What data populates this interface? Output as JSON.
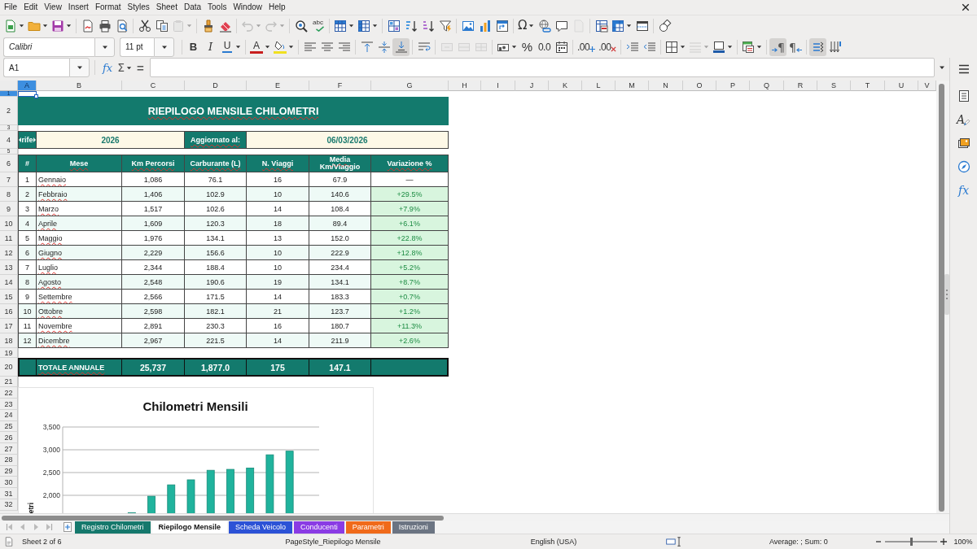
{
  "menu": [
    "File",
    "Edit",
    "View",
    "Insert",
    "Format",
    "Styles",
    "Sheet",
    "Data",
    "Tools",
    "Window",
    "Help"
  ],
  "standard_toolbar": [
    {
      "disabled": false
    },
    {
      "disabled": false
    },
    {
      "disabled": false
    },
    {
      "disabled": false
    },
    {
      "disabled": false
    },
    {
      "disabled": false
    },
    {
      "disabled": false
    },
    {
      "disabled": false
    },
    {
      "disabled": true
    },
    {
      "disabled": false
    },
    {
      "disabled": false
    },
    {
      "disabled": true
    },
    {
      "disabled": true
    },
    {
      "disabled": false
    },
    {
      "glyph": "abc",
      "disabled": false
    },
    {
      "disabled": false
    },
    {
      "disabled": false
    },
    {
      "disabled": false
    },
    {
      "disabled": false
    },
    {
      "disabled": false
    },
    {
      "disabled": false
    },
    {
      "disabled": false
    },
    {
      "disabled": false
    },
    {
      "disabled": false
    },
    {
      "glyph": "Ω",
      "disabled": false
    },
    {
      "disabled": false
    },
    {
      "disabled": false
    },
    {
      "disabled": true
    },
    {
      "disabled": false
    },
    {
      "disabled": false
    },
    {
      "disabled": false
    },
    {
      "disabled": false
    }
  ],
  "formatting_toolbar": {
    "font_name": "Calibri",
    "font_size": "11 pt",
    "buttons": [
      {
        "glyph": "B",
        "pressed": false,
        "disabled": false
      },
      {
        "glyph": "I",
        "pressed": false,
        "disabled": false
      },
      {
        "glyph": "U",
        "pressed": false,
        "disabled": false
      },
      {
        "glyph": "A",
        "pressed": false,
        "disabled": false
      },
      {
        "pressed": false,
        "disabled": false
      },
      {
        "pressed": false,
        "disabled": false
      },
      {
        "pressed": false,
        "disabled": false
      },
      {
        "pressed": false,
        "disabled": false
      },
      {
        "pressed": false,
        "disabled": false
      },
      {
        "pressed": false,
        "disabled": false
      },
      {
        "pressed": true,
        "disabled": false
      },
      {
        "pressed": false,
        "disabled": false
      },
      {
        "pressed": false,
        "disabled": true
      },
      {
        "pressed": false,
        "disabled": true
      },
      {
        "pressed": false,
        "disabled": true
      },
      {
        "pressed": false,
        "disabled": false
      },
      {
        "glyph": "%",
        "pressed": false,
        "disabled": false
      },
      {
        "glyph": "0.0",
        "pressed": false,
        "disabled": false
      },
      {
        "pressed": false,
        "disabled": false
      },
      {
        "glyph": ".00",
        "pressed": false,
        "disabled": false
      },
      {
        "glyph": ".00",
        "pressed": false,
        "disabled": false
      },
      {
        "pressed": false,
        "disabled": false
      },
      {
        "pressed": false,
        "disabled": false
      },
      {
        "pressed": false,
        "disabled": false
      },
      {
        "pressed": false,
        "disabled": true
      },
      {
        "pressed": false,
        "disabled": false
      },
      {
        "pressed": false,
        "disabled": false
      },
      {
        "glyph": "¶",
        "pressed": true,
        "disabled": false
      },
      {
        "glyph": "¶",
        "pressed": false,
        "disabled": false
      },
      {
        "pressed": true,
        "disabled": false
      },
      {
        "pressed": false,
        "disabled": false
      }
    ]
  },
  "formula_bar": {
    "cell_reference": "A1",
    "function_wizard": "fx",
    "sum": "Σ",
    "equals": "="
  },
  "sidebar": {
    "styles": "A",
    "functions": "fx"
  },
  "column_headers": [
    {
      "label": "A",
      "selected": true
    },
    {
      "label": "B",
      "selected": false
    },
    {
      "label": "C",
      "selected": false
    },
    {
      "label": "D",
      "selected": false
    },
    {
      "label": "E",
      "selected": false
    },
    {
      "label": "F",
      "selected": false
    },
    {
      "label": "G",
      "selected": false
    },
    {
      "label": "H",
      "selected": false
    },
    {
      "label": "I",
      "selected": false
    },
    {
      "label": "J",
      "selected": false
    },
    {
      "label": "K",
      "selected": false
    },
    {
      "label": "L",
      "selected": false
    },
    {
      "label": "M",
      "selected": false
    },
    {
      "label": "N",
      "selected": false
    },
    {
      "label": "O",
      "selected": false
    },
    {
      "label": "P",
      "selected": false
    },
    {
      "label": "Q",
      "selected": false
    },
    {
      "label": "R",
      "selected": false
    },
    {
      "label": "S",
      "selected": false
    },
    {
      "label": "T",
      "selected": false
    },
    {
      "label": "U",
      "selected": false
    },
    {
      "label": "V",
      "selected": false
    }
  ],
  "row_headers": [
    {
      "label": "1",
      "selected": true
    },
    {
      "label": "2",
      "selected": false
    },
    {
      "label": "3",
      "selected": false
    },
    {
      "label": "4",
      "selected": false
    },
    {
      "label": "5",
      "selected": false
    },
    {
      "label": "6",
      "selected": false
    },
    {
      "label": "7",
      "selected": false
    },
    {
      "label": "8",
      "selected": false
    },
    {
      "label": "9",
      "selected": false
    },
    {
      "label": "10",
      "selected": false
    },
    {
      "label": "11",
      "selected": false
    },
    {
      "label": "12",
      "selected": false
    },
    {
      "label": "13",
      "selected": false
    },
    {
      "label": "14",
      "selected": false
    },
    {
      "label": "15",
      "selected": false
    },
    {
      "label": "16",
      "selected": false
    },
    {
      "label": "17",
      "selected": false
    },
    {
      "label": "18",
      "selected": false
    },
    {
      "label": "19",
      "selected": false
    },
    {
      "label": "20",
      "selected": false
    },
    {
      "label": "21",
      "selected": false
    },
    {
      "label": "22",
      "selected": false
    },
    {
      "label": "23",
      "selected": false
    },
    {
      "label": "24",
      "selected": false
    },
    {
      "label": "25",
      "selected": false
    },
    {
      "label": "26",
      "selected": false
    },
    {
      "label": "27",
      "selected": false
    },
    {
      "label": "28",
      "selected": false
    },
    {
      "label": "29",
      "selected": false
    },
    {
      "label": "30",
      "selected": false
    },
    {
      "label": "31",
      "selected": false
    },
    {
      "label": "32",
      "selected": false
    }
  ],
  "sheet": {
    "title": {
      "text": "RIEPILOGO MENSILE CHILOMETRI",
      "misspelled": true
    },
    "info": [
      {
        "kind": "label",
        "text": "rife",
        "overflow": true
      },
      {
        "kind": "value",
        "text": "2026"
      },
      {
        "kind": "label",
        "text": "Aggiornato al:",
        "misspelled": true
      },
      {
        "kind": "value",
        "text": "06/03/2026"
      }
    ],
    "table": {
      "columns": [
        {
          "label": "#",
          "misspelled": false
        },
        {
          "label": "Mese",
          "misspelled": true
        },
        {
          "label": "Km Percorsi",
          "misspelled": true
        },
        {
          "label": "Carburante (L)",
          "misspelled": true
        },
        {
          "label": "N. Viaggi",
          "misspelled": true
        },
        {
          "label": "Media Km/Viaggio",
          "misspelled": true
        },
        {
          "label": "Variazione %",
          "misspelled": true
        }
      ],
      "rows": [
        {
          "n": "1",
          "month": "Gennaio",
          "km": "1,086",
          "fuel": "76.1",
          "trips": "16",
          "avg": "67.9",
          "change": "—",
          "change_highlighted": false,
          "misspelled": true
        },
        {
          "n": "2",
          "month": "Febbraio",
          "km": "1,406",
          "fuel": "102.9",
          "trips": "10",
          "avg": "140.6",
          "change": "+29.5%",
          "change_highlighted": true,
          "misspelled": true
        },
        {
          "n": "3",
          "month": "Marzo",
          "km": "1,517",
          "fuel": "102.6",
          "trips": "14",
          "avg": "108.4",
          "change": "+7.9%",
          "change_highlighted": true,
          "misspelled": true
        },
        {
          "n": "4",
          "month": "Aprile",
          "km": "1,609",
          "fuel": "120.3",
          "trips": "18",
          "avg": "89.4",
          "change": "+6.1%",
          "change_highlighted": true,
          "misspelled": true
        },
        {
          "n": "5",
          "month": "Maggio",
          "km": "1,976",
          "fuel": "134.1",
          "trips": "13",
          "avg": "152.0",
          "change": "+22.8%",
          "change_highlighted": true,
          "misspelled": true
        },
        {
          "n": "6",
          "month": "Giugno",
          "km": "2,229",
          "fuel": "156.6",
          "trips": "10",
          "avg": "222.9",
          "change": "+12.8%",
          "change_highlighted": true,
          "misspelled": true
        },
        {
          "n": "7",
          "month": "Luglio",
          "km": "2,344",
          "fuel": "188.4",
          "trips": "10",
          "avg": "234.4",
          "change": "+5.2%",
          "change_highlighted": true,
          "misspelled": true
        },
        {
          "n": "8",
          "month": "Agosto",
          "km": "2,548",
          "fuel": "190.6",
          "trips": "19",
          "avg": "134.1",
          "change": "+8.7%",
          "change_highlighted": true,
          "misspelled": true
        },
        {
          "n": "9",
          "month": "Settembre",
          "km": "2,566",
          "fuel": "171.5",
          "trips": "14",
          "avg": "183.3",
          "change": "+0.7%",
          "change_highlighted": true,
          "misspelled": true
        },
        {
          "n": "10",
          "month": "Ottobre",
          "km": "2,598",
          "fuel": "182.1",
          "trips": "21",
          "avg": "123.7",
          "change": "+1.2%",
          "change_highlighted": true,
          "misspelled": true
        },
        {
          "n": "11",
          "month": "Novembre",
          "km": "2,891",
          "fuel": "230.3",
          "trips": "16",
          "avg": "180.7",
          "change": "+11.3%",
          "change_highlighted": true,
          "misspelled": true
        },
        {
          "n": "12",
          "month": "Dicembre",
          "km": "2,967",
          "fuel": "221.5",
          "trips": "14",
          "avg": "211.9",
          "change": "+2.6%",
          "change_highlighted": true,
          "misspelled": true
        }
      ],
      "total": {
        "label": "TOTALE ANNUALE",
        "misspelled": true,
        "km": "25,737",
        "fuel": "1,877.0",
        "trips": "175",
        "avg": "147.1"
      }
    }
  },
  "chart": {
    "chart_data": {
      "type": "bar",
      "title": "Chilometri Mensili",
      "ylabel": "etri",
      "categories": [
        null,
        null,
        null,
        null,
        null,
        null,
        null,
        null,
        null,
        null,
        null,
        null,
        null
      ],
      "values": [
        null,
        null,
        null,
        1620,
        1980,
        2230,
        2340,
        2550,
        2570,
        2600,
        2890,
        2970,
        null
      ],
      "ylim": [
        1590,
        3500
      ],
      "yticks": [
        {
          "value": 2000,
          "label": "2,000"
        },
        {
          "value": 2500,
          "label": "2,500"
        },
        {
          "value": 3000,
          "label": "3,000"
        },
        {
          "value": 3500,
          "label": "3,500"
        }
      ],
      "grid": true
    }
  },
  "sheet_tabs": [
    {
      "label": "Registro Chilometri",
      "color": "#15786c",
      "selected": false
    },
    {
      "label": "Riepilogo Mensile",
      "selected": true
    },
    {
      "label": "Scheda Veicolo",
      "color": "#2c52d6",
      "selected": false
    },
    {
      "label": "Conducenti",
      "color": "#8a3be4",
      "selected": false
    },
    {
      "label": "Parametri",
      "color": "#f06a1a",
      "selected": false
    },
    {
      "label": "Istruzioni",
      "color": "#6b7482",
      "selected": false
    }
  ],
  "status_bar": {
    "sheet": "Sheet 2 of 6",
    "page_style": "PageStyle_Riepilogo Mensile",
    "language": "English (USA)",
    "summary": "Average: ; Sum: 0",
    "zoom_slider": {
      "level": 0.5
    },
    "zoom": "100%"
  }
}
